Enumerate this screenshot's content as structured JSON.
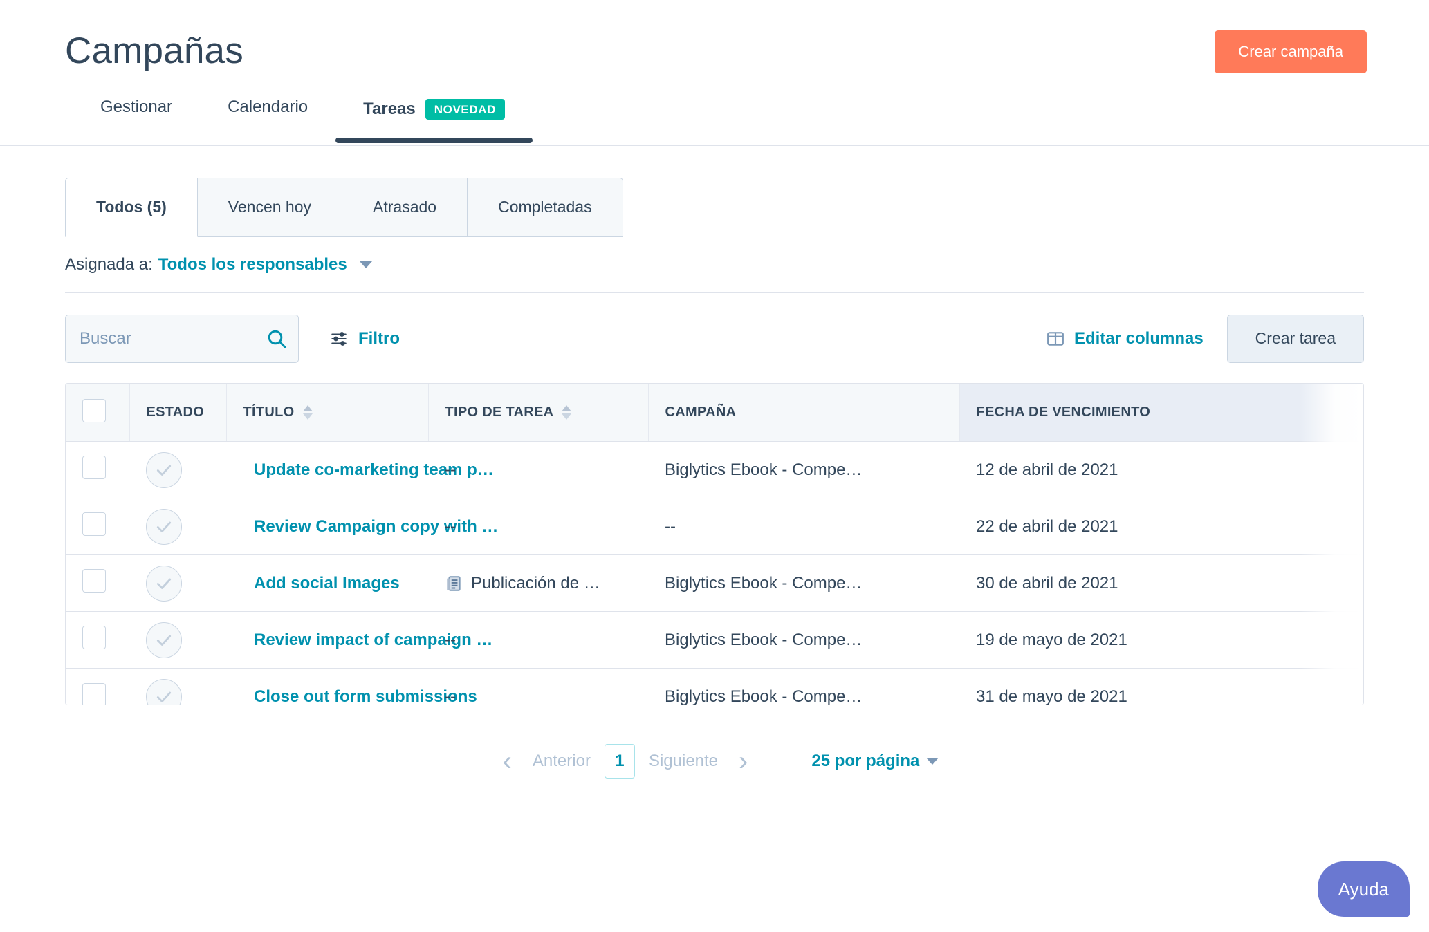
{
  "header": {
    "title": "Campañas",
    "create_campaign_label": "Crear campaña"
  },
  "top_nav": {
    "tabs": [
      {
        "label": "Gestionar",
        "active": false,
        "badge": ""
      },
      {
        "label": "Calendario",
        "active": false,
        "badge": ""
      },
      {
        "label": "Tareas",
        "active": true,
        "badge": "NOVEDAD"
      }
    ]
  },
  "segmented_tabs": [
    {
      "label": "Todos (5)",
      "active": true
    },
    {
      "label": "Vencen hoy",
      "active": false
    },
    {
      "label": "Atrasado",
      "active": false
    },
    {
      "label": "Completadas",
      "active": false
    }
  ],
  "assigned": {
    "label": "Asignada a:",
    "value": "Todos los responsables"
  },
  "toolbar": {
    "search_placeholder": "Buscar",
    "search_value": "",
    "filter_label": "Filtro",
    "edit_columns_label": "Editar columnas",
    "create_task_label": "Crear tarea"
  },
  "table": {
    "columns": [
      {
        "key": "checkbox",
        "label": "",
        "sortable": false,
        "sorted": false
      },
      {
        "key": "status",
        "label": "ESTADO",
        "sortable": false,
        "sorted": false
      },
      {
        "key": "title",
        "label": "TÍTULO",
        "sortable": true,
        "sorted": false
      },
      {
        "key": "type",
        "label": "TIPO DE TAREA",
        "sortable": true,
        "sorted": false
      },
      {
        "key": "campaign",
        "label": "CAMPAÑA",
        "sortable": false,
        "sorted": false
      },
      {
        "key": "due",
        "label": "FECHA DE VENCIMIENTO",
        "sortable": false,
        "sorted": true
      }
    ],
    "rows": [
      {
        "title": "Update co-marketing team p…",
        "type": "--",
        "type_icon": "",
        "campaign": "Biglytics Ebook - Compe…",
        "due": "12 de abril de 2021",
        "overdue": true
      },
      {
        "title": "Review Campaign copy with …",
        "type": "--",
        "type_icon": "",
        "campaign": "--",
        "due": "22 de abril de 2021",
        "overdue": true
      },
      {
        "title": "Add social Images",
        "type": "Publicación de …",
        "type_icon": "document-icon",
        "campaign": "Biglytics Ebook - Compe…",
        "due": "30 de abril de 2021",
        "overdue": false
      },
      {
        "title": "Review impact of campaign …",
        "type": "--",
        "type_icon": "",
        "campaign": "Biglytics Ebook - Compe…",
        "due": "19 de mayo de 2021",
        "overdue": false
      },
      {
        "title": "Close out form submissions",
        "type": "--",
        "type_icon": "",
        "campaign": "Biglytics Ebook - Compe…",
        "due": "31 de mayo de 2021",
        "overdue": false
      }
    ]
  },
  "pagination": {
    "previous_label": "Anterior",
    "current_page": "1",
    "next_label": "Siguiente",
    "per_page_label": "25 por página"
  },
  "help": {
    "label": "Ayuda"
  },
  "colors": {
    "brand_orange": "#FF7A59",
    "link_teal": "#0091AE",
    "badge_green": "#00BDA5",
    "navy": "#33475B",
    "overdue_red": "#F2545B",
    "help_purple": "#6A78D1"
  }
}
